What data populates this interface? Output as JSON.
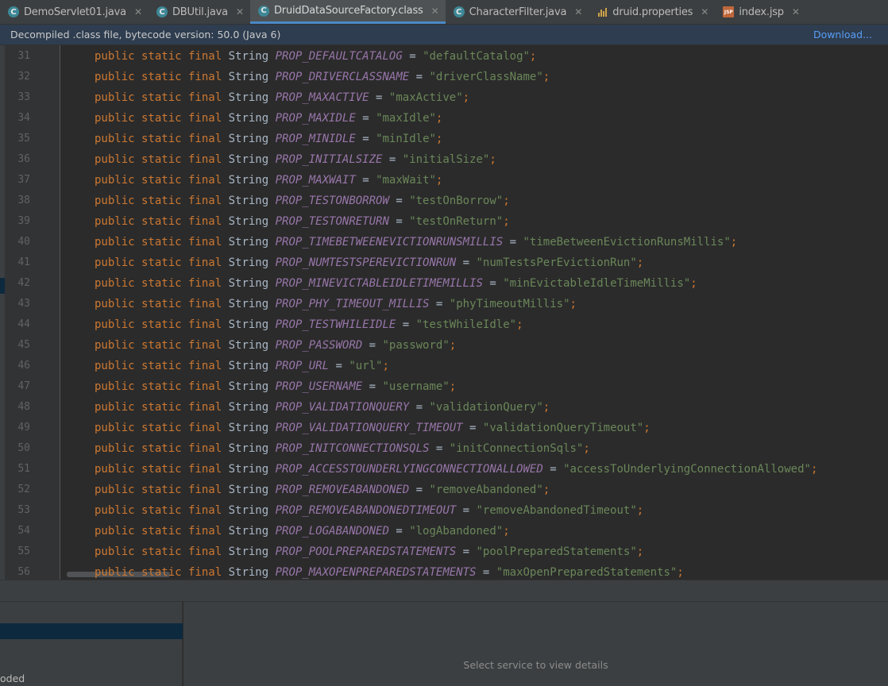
{
  "tabs": [
    {
      "label": "DemoServlet01.java",
      "icon": "c-class-icon",
      "active": false
    },
    {
      "label": "DBUtil.java",
      "icon": "c-class-icon",
      "active": false
    },
    {
      "label": "DruidDataSourceFactory.class",
      "icon": "c-class-icon",
      "active": true
    },
    {
      "label": "CharacterFilter.java",
      "icon": "c-class-icon",
      "active": false
    },
    {
      "label": "druid.properties",
      "icon": "properties-icon",
      "active": false
    },
    {
      "label": "index.jsp",
      "icon": "jsp-icon",
      "active": false
    }
  ],
  "banner": {
    "text": "Decompiled .class file, bytecode version: 50.0 (Java 6)",
    "link": "Download..."
  },
  "code": {
    "keyword_prefix": "public static final",
    "type": "String",
    "lines": [
      {
        "n": "31",
        "name": "PROP_DEFAULTCATALOG",
        "value": "\"defaultCatalog\""
      },
      {
        "n": "32",
        "name": "PROP_DRIVERCLASSNAME",
        "value": "\"driverClassName\""
      },
      {
        "n": "33",
        "name": "PROP_MAXACTIVE",
        "value": "\"maxActive\""
      },
      {
        "n": "34",
        "name": "PROP_MAXIDLE",
        "value": "\"maxIdle\""
      },
      {
        "n": "35",
        "name": "PROP_MINIDLE",
        "value": "\"minIdle\""
      },
      {
        "n": "36",
        "name": "PROP_INITIALSIZE",
        "value": "\"initialSize\""
      },
      {
        "n": "37",
        "name": "PROP_MAXWAIT",
        "value": "\"maxWait\""
      },
      {
        "n": "38",
        "name": "PROP_TESTONBORROW",
        "value": "\"testOnBorrow\""
      },
      {
        "n": "39",
        "name": "PROP_TESTONRETURN",
        "value": "\"testOnReturn\""
      },
      {
        "n": "40",
        "name": "PROP_TIMEBETWEENEVICTIONRUNSMILLIS",
        "value": "\"timeBetweenEvictionRunsMillis\""
      },
      {
        "n": "41",
        "name": "PROP_NUMTESTSPEREVICTIONRUN",
        "value": "\"numTestsPerEvictionRun\""
      },
      {
        "n": "42",
        "name": "PROP_MINEVICTABLEIDLETIMEMILLIS",
        "value": "\"minEvictableIdleTimeMillis\""
      },
      {
        "n": "43",
        "name": "PROP_PHY_TIMEOUT_MILLIS",
        "value": "\"phyTimeoutMillis\""
      },
      {
        "n": "44",
        "name": "PROP_TESTWHILEIDLE",
        "value": "\"testWhileIdle\""
      },
      {
        "n": "45",
        "name": "PROP_PASSWORD",
        "value": "\"password\""
      },
      {
        "n": "46",
        "name": "PROP_URL",
        "value": "\"url\""
      },
      {
        "n": "47",
        "name": "PROP_USERNAME",
        "value": "\"username\""
      },
      {
        "n": "48",
        "name": "PROP_VALIDATIONQUERY",
        "value": "\"validationQuery\""
      },
      {
        "n": "49",
        "name": "PROP_VALIDATIONQUERY_TIMEOUT",
        "value": "\"validationQueryTimeout\""
      },
      {
        "n": "50",
        "name": "PROP_INITCONNECTIONSQLS",
        "value": "\"initConnectionSqls\""
      },
      {
        "n": "51",
        "name": "PROP_ACCESSTOUNDERLYINGCONNECTIONALLOWED",
        "value": "\"accessToUnderlyingConnectionAllowed\""
      },
      {
        "n": "52",
        "name": "PROP_REMOVEABANDONED",
        "value": "\"removeAbandoned\""
      },
      {
        "n": "53",
        "name": "PROP_REMOVEABANDONEDTIMEOUT",
        "value": "\"removeAbandonedTimeout\""
      },
      {
        "n": "54",
        "name": "PROP_LOGABANDONED",
        "value": "\"logAbandoned\""
      },
      {
        "n": "55",
        "name": "PROP_POOLPREPAREDSTATEMENTS",
        "value": "\"poolPreparedStatements\""
      },
      {
        "n": "56",
        "name": "PROP_MAXOPENPREPAREDSTATEMENTS",
        "value": "\"maxOpenPreparedStatements\""
      }
    ]
  },
  "bottom": {
    "left_status": "oded",
    "detail_hint": "Select service to view details"
  },
  "colors": {
    "keyword": "#cc7832",
    "constant": "#9876aa",
    "string": "#6a8759",
    "link": "#589df6"
  }
}
